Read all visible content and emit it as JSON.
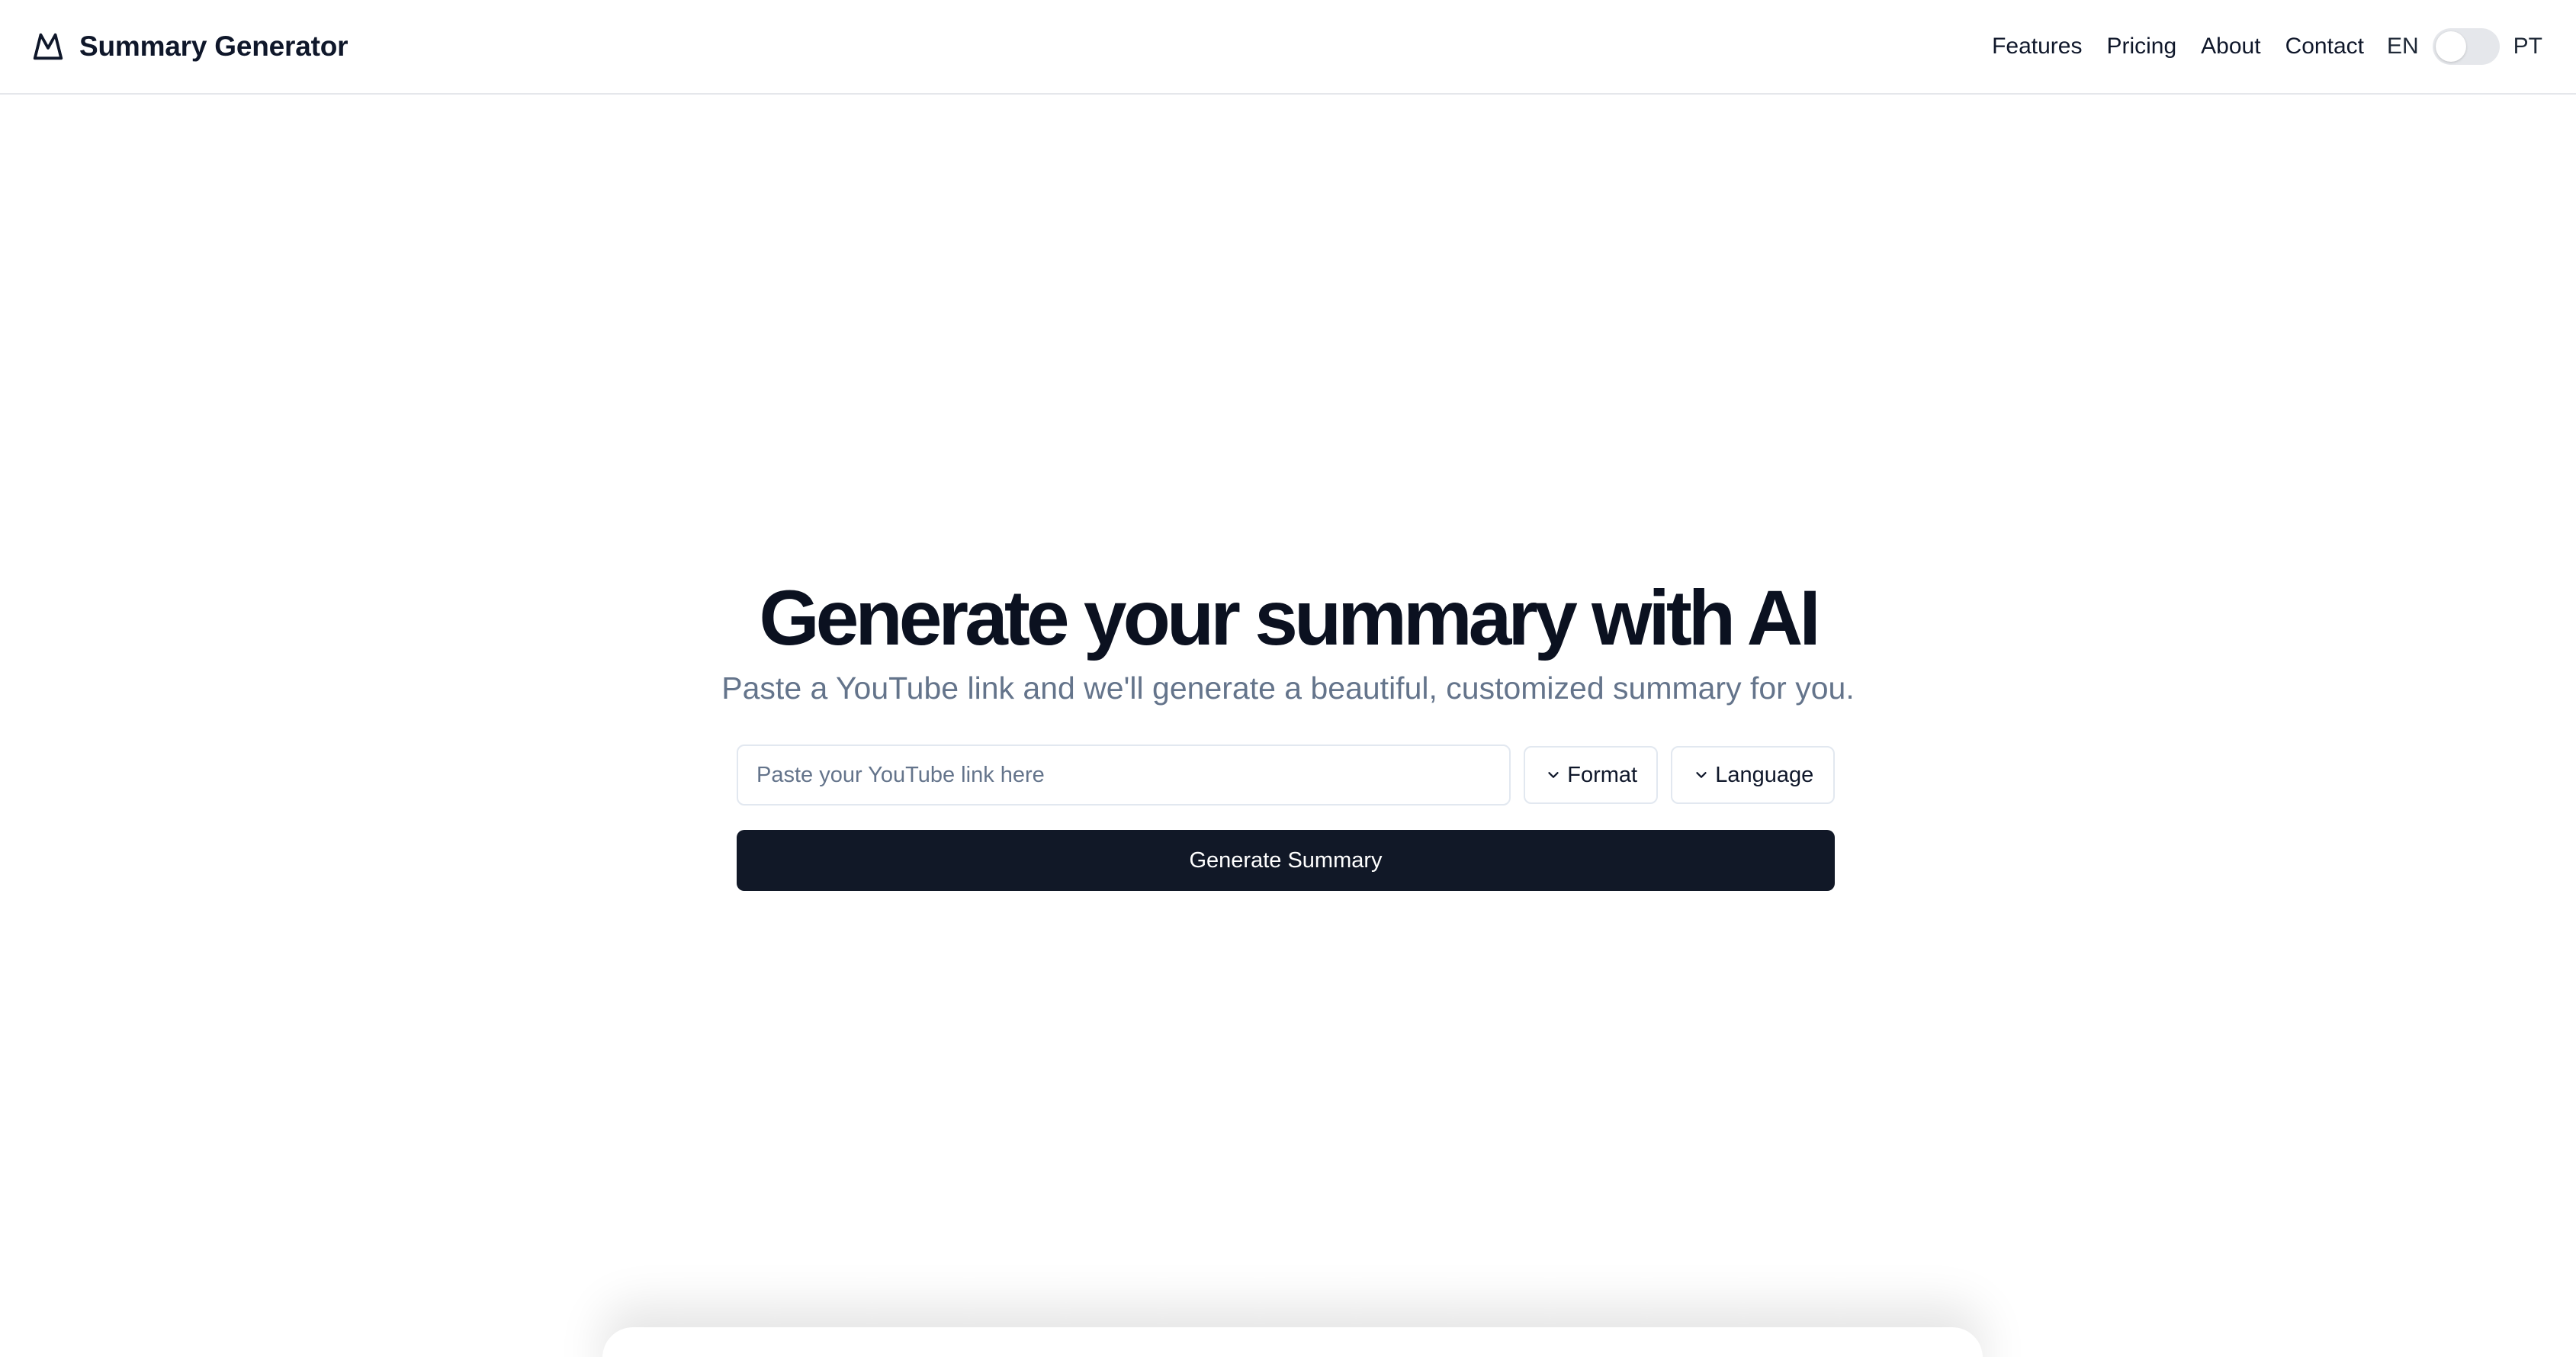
{
  "header": {
    "brand": "Summary Generator",
    "logo_icon": "mountain-icon",
    "nav": [
      {
        "label": "Features"
      },
      {
        "label": "Pricing"
      },
      {
        "label": "About"
      },
      {
        "label": "Contact"
      }
    ],
    "lang_left": "EN",
    "lang_right": "PT",
    "lang_toggle_on": false
  },
  "hero": {
    "title": "Generate your summary with AI",
    "subtitle": "Paste a YouTube link and we'll generate a beautiful, customized summary for you."
  },
  "form": {
    "url_placeholder": "Paste your YouTube link here",
    "url_value": "",
    "format_label": "Format",
    "language_label": "Language",
    "submit_label": "Generate Summary"
  },
  "colors": {
    "primary_button": "#111827",
    "subtitle_text": "#64748b",
    "border": "#e2e8f0"
  }
}
